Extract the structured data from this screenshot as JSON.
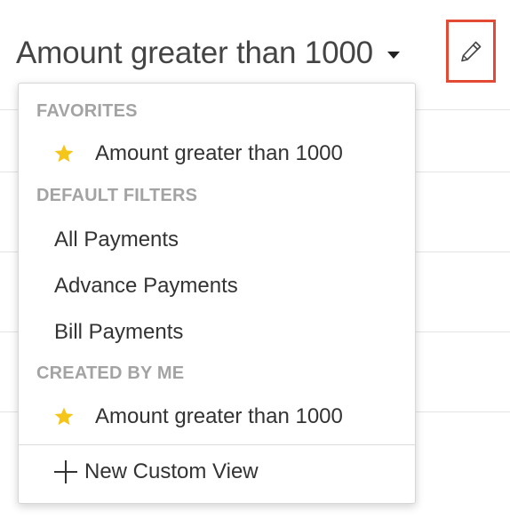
{
  "header": {
    "title": "Amount greater than 1000",
    "caret_icon": "caret-down-icon",
    "edit_icon": "pencil-icon",
    "edit_highlight_color": "#e24a34"
  },
  "dropdown": {
    "sections": [
      {
        "label": "FAVORITES",
        "items": [
          {
            "label": "Amount greater than 1000",
            "icon": "star-icon"
          }
        ]
      },
      {
        "label": "DEFAULT FILTERS",
        "items": [
          {
            "label": "All Payments"
          },
          {
            "label": "Advance Payments"
          },
          {
            "label": "Bill Payments"
          }
        ]
      },
      {
        "label": "CREATED BY ME",
        "items": [
          {
            "label": "Amount greater than 1000",
            "icon": "star-icon"
          }
        ]
      }
    ],
    "new_view_label": "New Custom View",
    "new_view_icon": "plus-icon",
    "star_color": "#f5c518"
  }
}
